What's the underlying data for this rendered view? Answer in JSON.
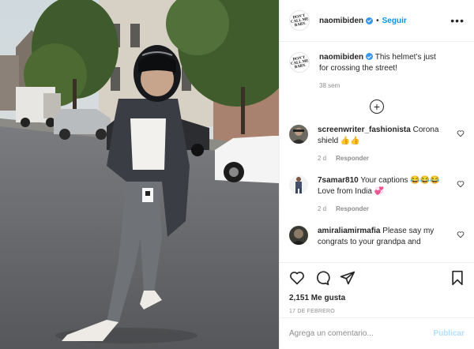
{
  "header": {
    "username": "naomibiden",
    "separator": "•",
    "follow_label": "Seguir",
    "more_label": "•••",
    "logo_lines": [
      "DON'T",
      "CALL ME",
      "BABY."
    ]
  },
  "caption": {
    "username": "naomibiden",
    "text": "This helmet’s just for crossing the street!",
    "age": "38 sem"
  },
  "load_more_label": "+",
  "comments": [
    {
      "username": "screenwriter_fashionista",
      "text": "Corona shield 👍👍",
      "age": "2 d",
      "reply": "Responder"
    },
    {
      "username": "7samar810",
      "text": "Your captions 😂😂😂 Love from India 💞",
      "age": "2 d",
      "reply": "Responder"
    },
    {
      "username": "amiraliamirmafia",
      "text": "Please say my congrats to your grandpa and",
      "age": "",
      "reply": ""
    }
  ],
  "actions": {
    "likes": "2,151 Me gusta",
    "date": "17 DE FEBRERO"
  },
  "add_comment": {
    "placeholder": "Agrega un comentario...",
    "publish_label": "Publicar"
  },
  "colors": {
    "link_blue": "#0095f6",
    "verified_blue": "#3897f0",
    "muted": "#8e8e8e",
    "publish_disabled": "#b2dffc"
  }
}
